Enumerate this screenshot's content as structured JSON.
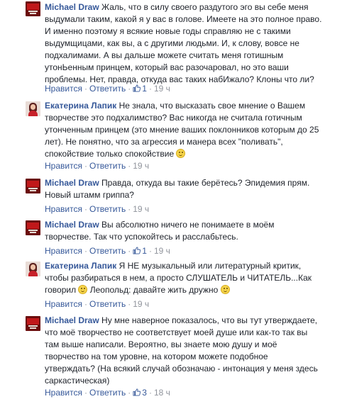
{
  "colors": {
    "link": "#365899",
    "meta": "#90949c",
    "text": "#1d2129"
  },
  "comments": [
    {
      "author": "Michael Draw",
      "avatar": "michael-draw-avatar",
      "text": " Жаль, что в силу своего раздутого эго вы себе меня\nвыдумали таким, какой я у вас в голове. Имеете на это полное право.\nИ именно поэтому я всякие новые годы справляю не с такими\nвыдумщицами, как вы, а с другими людьми. И, к слову, вовсе не\nподхалимами. А вы дальше можете считать меня готишным\nутонЬенным принцем, который вас разочаровал, но это ваши\nпроблемы. Нет, правда, откуда вас таких набИжало? Клоны что ли?",
      "like": "Нравится",
      "reply": "Ответить",
      "likes": "1",
      "time": "19 ч"
    },
    {
      "author": "Екатерина Лапик",
      "avatar": "ekaterina-lapik-avatar",
      "text": " Не знала, что высказать свое мнение о Вашем\nтворчестве это подхалимство? Вас никогда не считала готичным\nутонченным принцем (это мнение ваших поклонников которым до 25\nлет). Не понятно, что за агрессия и манера всех \"поливать\",\nспокойствие только спокойствие ",
      "like": "Нравится",
      "reply": "Ответить",
      "time": "19 ч"
    },
    {
      "author": "Michael Draw",
      "avatar": "michael-draw-avatar",
      "text": " Правда, откуда вы такие берётесь? Эпидемия прям.\nНовый штамм гриппа?",
      "like": "Нравится",
      "reply": "Ответить",
      "time": "19 ч"
    },
    {
      "author": "Michael Draw",
      "avatar": "michael-draw-avatar",
      "text": " Вы абсолютно ничего не понимаете в моём\nтворчестве. Так что успокойтесь и расслабьтесь.",
      "like": "Нравится",
      "reply": "Ответить",
      "likes": "1",
      "time": "19 ч"
    },
    {
      "author": "Екатерина Лапик",
      "avatar": "ekaterina-lapik-avatar",
      "text_a": " Я НЕ музыкальный или литературный критик,\nчтобы разбираться в нем, а просто СЛУШАТЕЛЬ и ЧИТАТЕЛЬ...Как\nговорил ",
      "text_b": " Леопольд: давайте жить дружно ",
      "like": "Нравится",
      "reply": "Ответить",
      "time": "19 ч"
    },
    {
      "author": "Michael Draw",
      "avatar": "michael-draw-avatar",
      "text": " Ну мне наверное показалось, что вы тут утверждаете,\nчто моё творчество не соответствует моей душе или как-то так вы\nтам выше написали. Вероятно, вы знаете мою душу и моё\nтворчество на том уровне, на котором можете подобное\nутверждать? (На всякий случай обозначаю - интонация у меня здесь\nсаркастическая)",
      "like": "Нравится",
      "reply": "Ответить",
      "likes": "3",
      "time": "18 ч"
    }
  ]
}
